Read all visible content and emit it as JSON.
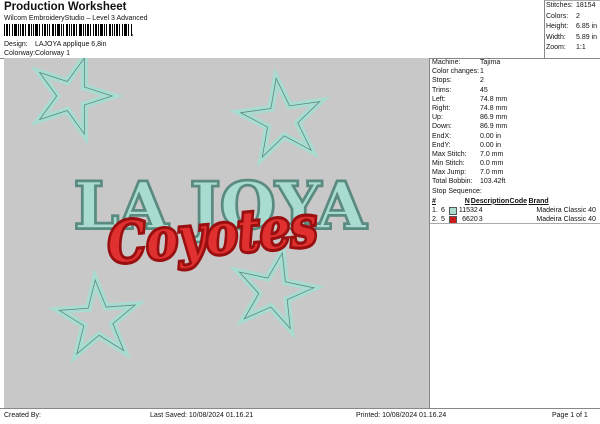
{
  "header": {
    "title": "Production Worksheet",
    "subtitle": "Wilcom EmbroideryStudio – Level 3 Advanced",
    "barcode_suffix": ","
  },
  "design": {
    "design_label": "Design:",
    "design_value": "LAJOYA applique 6,8in",
    "colorway_label": "Colorway:",
    "colorway_value": "Colorway 1"
  },
  "top_stats": [
    {
      "label": "Stitches:",
      "value": "18154"
    },
    {
      "label": "Colors:",
      "value": "2"
    },
    {
      "label": "Height:",
      "value": "6.85 in"
    },
    {
      "label": "Width:",
      "value": "5.89 in"
    },
    {
      "label": "Zoom:",
      "value": "1:1"
    }
  ],
  "machine_info": [
    {
      "label": "Machine:",
      "value": "Tajima"
    },
    {
      "label": "Color changes:",
      "value": "1"
    },
    {
      "label": "Stops:",
      "value": "2"
    },
    {
      "label": "Trims:",
      "value": "45"
    },
    {
      "label": "Left:",
      "value": "74.8 mm"
    },
    {
      "label": "Right:",
      "value": "74.8 mm"
    },
    {
      "label": "Up:",
      "value": "86.9 mm"
    },
    {
      "label": "Down:",
      "value": "86.9 mm"
    },
    {
      "label": "EndX:",
      "value": "0.00 in"
    },
    {
      "label": "EndY:",
      "value": "0.00 in"
    },
    {
      "label": "Max Stitch:",
      "value": "7.0 mm"
    },
    {
      "label": "Min Stitch:",
      "value": "0.0 mm"
    },
    {
      "label": "Max Jump:",
      "value": "7.0 mm"
    },
    {
      "label": "Total Bobbin:",
      "value": "103.42ft"
    }
  ],
  "stop_sequence": {
    "title": "Stop Sequence:",
    "headers": {
      "num": "#",
      "stitches": "N",
      "description": "Description",
      "code": "Code",
      "brand": "Brand"
    },
    "rows": [
      {
        "num": "1.",
        "stop": "6",
        "color": "#a8dcd0",
        "stitches": "11532",
        "description": "4",
        "code": "",
        "brand": "Madeira Classic 40"
      },
      {
        "num": "2.",
        "stop": "5",
        "color": "#cc1a1a",
        "stitches": "6620",
        "description": "3",
        "code": "",
        "brand": "Madeira Classic 40"
      }
    ]
  },
  "artwork": {
    "line1": "LA JOYA",
    "line2": "Coyotes",
    "mint": "#a8dcd0",
    "mint_dark": "#5a8a80",
    "red": "#e03030",
    "red_dark": "#9a1010",
    "background": "#c8c8c8"
  },
  "footer": {
    "created_by": "Created By:",
    "last_saved": "Last Saved: 10/08/2024 01.16.21",
    "printed": "Printed: 10/08/2024 01.16.24",
    "page": "Page 1 of 1"
  }
}
